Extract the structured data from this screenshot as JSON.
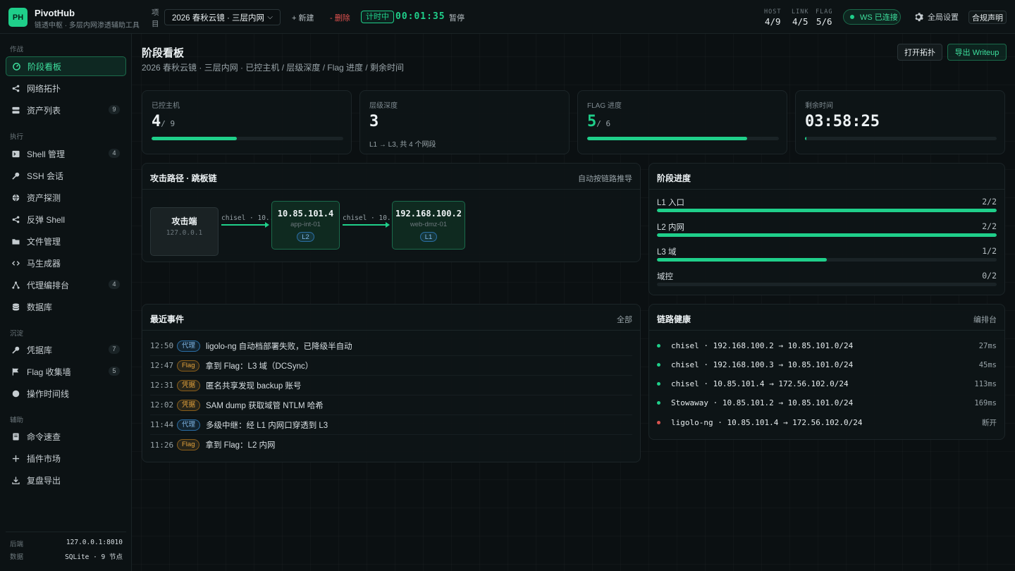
{
  "brand": {
    "logo": "PH",
    "name": "PivotHub",
    "subtitle": "链透中枢 · 多层内网渗透辅助工具"
  },
  "topbar": {
    "project_label": "项目",
    "project_value": "2026 春秋云镜 · 三层内网",
    "new_label": "+ 新建",
    "delete_label": "- 删除",
    "timer_badge": "计时中",
    "timer_value": "00:01:35",
    "pause_label": "暂停",
    "stats": [
      {
        "label": "HOST",
        "value": "4/9"
      },
      {
        "label": "LINK",
        "value": "4/5"
      },
      {
        "label": "FLAG",
        "value": "5/6"
      }
    ],
    "ws_status": "WS 已连接",
    "settings_label": "全局设置",
    "compliance_label": "合规声明"
  },
  "sidebar": {
    "sections": [
      {
        "title": "作战",
        "items": [
          {
            "label": "阶段看板",
            "icon": "dashboard-icon",
            "active": true
          },
          {
            "label": "网络拓扑",
            "icon": "share-icon"
          },
          {
            "label": "资产列表",
            "icon": "server-icon",
            "badge": "9"
          }
        ]
      },
      {
        "title": "执行",
        "items": [
          {
            "label": "Shell 管理",
            "icon": "terminal-icon",
            "badge": "4"
          },
          {
            "label": "SSH 会话",
            "icon": "key-icon"
          },
          {
            "label": "资产探测",
            "icon": "globe-icon"
          },
          {
            "label": "反弹 Shell",
            "icon": "share-icon"
          },
          {
            "label": "文件管理",
            "icon": "folder-icon"
          },
          {
            "label": "马生成器",
            "icon": "code-icon"
          },
          {
            "label": "代理编排台",
            "icon": "sitemap-icon",
            "badge": "4"
          },
          {
            "label": "数据库",
            "icon": "database-icon"
          }
        ]
      },
      {
        "title": "沉淀",
        "items": [
          {
            "label": "凭据库",
            "icon": "key-icon",
            "badge": "7"
          },
          {
            "label": "Flag 收集墙",
            "icon": "flag-icon",
            "badge": "5"
          },
          {
            "label": "操作时间线",
            "icon": "circle-icon"
          }
        ]
      },
      {
        "title": "辅助",
        "items": [
          {
            "label": "命令速查",
            "icon": "note-icon"
          },
          {
            "label": "插件市场",
            "icon": "plus-icon"
          },
          {
            "label": "复盘导出",
            "icon": "download-icon"
          }
        ]
      }
    ],
    "footer": [
      {
        "key": "后端",
        "value": "127.0.0.1:8010"
      },
      {
        "key": "数据",
        "value": "SQLite · 9 节点"
      }
    ]
  },
  "main": {
    "title": "阶段看板",
    "subtitle": "2026 春秋云镜 · 三层内网 · 已控主机 / 层级深度 / Flag 进度 / 剩余时间",
    "open_topology": "打开拓扑",
    "export_writeup": "导出 Writeup",
    "kpis": [
      {
        "label": "已控主机",
        "value": "4",
        "of": "/ 9",
        "fraction": 0.444
      },
      {
        "label": "层级深度",
        "value": "3",
        "note": "L1 → L3, 共 4 个网段"
      },
      {
        "label": "FLAG 进度",
        "value": "5",
        "of": "/ 6",
        "fraction": 0.833,
        "green": true
      },
      {
        "label": "剩余时间",
        "value": "03:58:25",
        "fraction": 0.008
      }
    ],
    "attack_path": {
      "title": "攻击路径 · 跳板链",
      "action": "自动按链路推导",
      "nodes": [
        {
          "ip": "攻击端",
          "name": "127.0.0.1",
          "tag": ""
        },
        {
          "ip": "10.85.101.4",
          "name": "app-int-01",
          "tag": "L2"
        },
        {
          "ip": "192.168.100.2",
          "name": "web-dmz-01",
          "tag": "L1"
        }
      ],
      "edges": [
        "chisel · 10...",
        "chisel · 10..."
      ]
    },
    "stage_progress": {
      "title": "阶段进度",
      "rows": [
        {
          "label": "L1 入口",
          "value": "2/2",
          "fraction": 1.0
        },
        {
          "label": "L2 内网",
          "value": "2/2",
          "fraction": 1.0
        },
        {
          "label": "L3 域",
          "value": "1/2",
          "fraction": 0.5
        },
        {
          "label": "域控",
          "value": "0/2",
          "fraction": 0.0
        }
      ]
    },
    "events": {
      "title": "最近事件",
      "action": "全部",
      "rows": [
        {
          "time": "12:50",
          "tag": "代理",
          "kind": "proxy",
          "text": "ligolo-ng 自动档部署失败，已降级半自动"
        },
        {
          "time": "12:47",
          "tag": "Flag",
          "kind": "flag",
          "text": "拿到 Flag：L3 域（DCSync）"
        },
        {
          "time": "12:31",
          "tag": "凭据",
          "kind": "flag",
          "text": "匿名共享发现 backup 账号"
        },
        {
          "time": "12:02",
          "tag": "凭据",
          "kind": "flag",
          "text": "SAM dump 获取域管 NTLM 哈希"
        },
        {
          "time": "11:44",
          "tag": "代理",
          "kind": "proxy",
          "text": "多级中继：经 L1 内网口穿透到 L3"
        },
        {
          "time": "11:26",
          "tag": "Flag",
          "kind": "flag",
          "text": "拿到 Flag：L2 内网"
        }
      ]
    },
    "link_health": {
      "title": "链路健康",
      "action": "编排台",
      "colors": {
        "ok": "#1fcf8a",
        "down": "#d9534f"
      },
      "rows": [
        {
          "text": "chisel · 192.168.100.2 → 10.85.101.0/24",
          "latency": "27ms",
          "status": "ok"
        },
        {
          "text": "chisel · 192.168.100.3 → 10.85.101.0/24",
          "latency": "45ms",
          "status": "ok"
        },
        {
          "text": "chisel · 10.85.101.4 → 172.56.102.0/24",
          "latency": "113ms",
          "status": "ok"
        },
        {
          "text": "Stowaway · 10.85.101.2 → 10.85.101.0/24",
          "latency": "169ms",
          "status": "ok"
        },
        {
          "text": "ligolo-ng · 10.85.101.4 → 172.56.102.0/24",
          "latency": "断开",
          "status": "down"
        }
      ]
    }
  }
}
